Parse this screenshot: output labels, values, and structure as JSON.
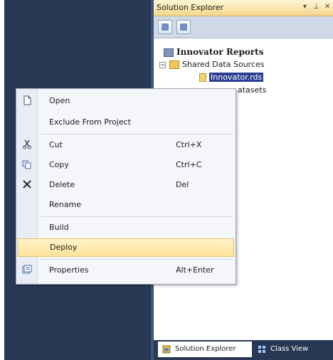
{
  "solution_explorer": {
    "title": "Solution Explorer",
    "controls": [
      "▾",
      "⊥",
      "✕"
    ],
    "tree": {
      "project": "Innovator Reports",
      "shared_data_sources": "Shared Data Sources",
      "expander_minus": "−",
      "selected_item": "Innovator.rds",
      "shared_datasets_partial": "atasets"
    },
    "bottom_tabs": {
      "active": "Solution Explorer",
      "inactive": "Class View"
    }
  },
  "context_menu": {
    "items": [
      {
        "label": "Open",
        "shortcut": "",
        "icon": "open-icon"
      },
      {
        "label": "Exclude From Project",
        "shortcut": "",
        "icon": ""
      },
      {
        "label": "Cut",
        "shortcut": "Ctrl+X",
        "icon": "cut-icon"
      },
      {
        "label": "Copy",
        "shortcut": "Ctrl+C",
        "icon": "copy-icon"
      },
      {
        "label": "Delete",
        "shortcut": "Del",
        "icon": "delete-icon"
      },
      {
        "label": "Rename",
        "shortcut": "",
        "icon": ""
      },
      {
        "label": "Build",
        "shortcut": "",
        "icon": ""
      },
      {
        "label": "Deploy",
        "shortcut": "",
        "icon": "",
        "highlighted": true
      },
      {
        "label": "Properties",
        "shortcut": "Alt+Enter",
        "icon": "properties-icon"
      }
    ]
  },
  "colors": {
    "ide_background": "#293955",
    "menu_highlight": "#ffe39a",
    "selection": "#2a3f8f"
  }
}
